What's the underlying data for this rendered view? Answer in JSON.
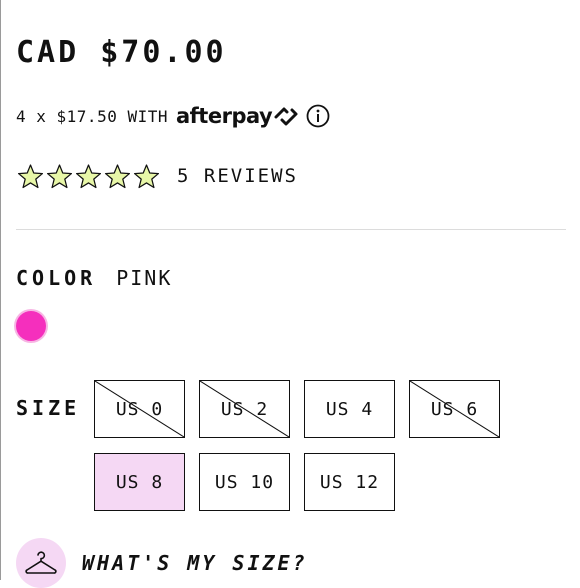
{
  "price": {
    "amount": "CAD $70.00"
  },
  "installments": {
    "text": "4 x $17.50 WITH",
    "brand": "afterpay",
    "info_icon": "info-circle-icon"
  },
  "rating": {
    "stars": 5,
    "star_color": "#e8f7a8",
    "reviews_label": "5 REVIEWS"
  },
  "color": {
    "label": "COLOR",
    "value": "PINK",
    "swatch_hex": "#f52fbd"
  },
  "size": {
    "label": "SIZE",
    "selected_color": "#f5d8f4",
    "options": [
      {
        "label": "US 0",
        "available": false
      },
      {
        "label": "US 2",
        "available": false
      },
      {
        "label": "US 4",
        "available": true
      },
      {
        "label": "US 6",
        "available": false
      },
      {
        "label": "US 8",
        "available": true,
        "selected": true
      },
      {
        "label": "US 10",
        "available": true
      },
      {
        "label": "US 12",
        "available": true
      }
    ]
  },
  "size_help": {
    "label": "WHAT'S MY SIZE?",
    "icon": "hanger-icon"
  }
}
